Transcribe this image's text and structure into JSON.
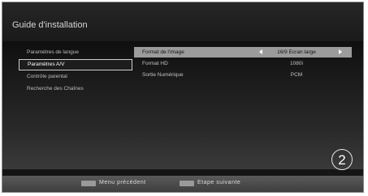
{
  "header": {
    "title": "Guide d'installation"
  },
  "menu": {
    "items": [
      {
        "label": "Paramètres de langue"
      },
      {
        "label": "Paramètres A/V"
      },
      {
        "label": "Contrôle parental"
      },
      {
        "label": "Recherche des Chaînes"
      }
    ],
    "selected_index": 1
  },
  "settings": {
    "rows": [
      {
        "label": "Format de l'image",
        "value": "16/9 Ecran large"
      },
      {
        "label": "Format HD",
        "value": "1080i"
      },
      {
        "label": "Sortie Numérique",
        "value": "PCM"
      }
    ],
    "active_index": 0
  },
  "step": {
    "number": "2",
    "symbol": "②"
  },
  "footer": {
    "back_label": "Menu précédent",
    "next_label": "Etape suivante"
  },
  "colors": {
    "background": "#151515",
    "highlight_row": "#9b9b9b",
    "footer_key": "#9a9a9a"
  }
}
